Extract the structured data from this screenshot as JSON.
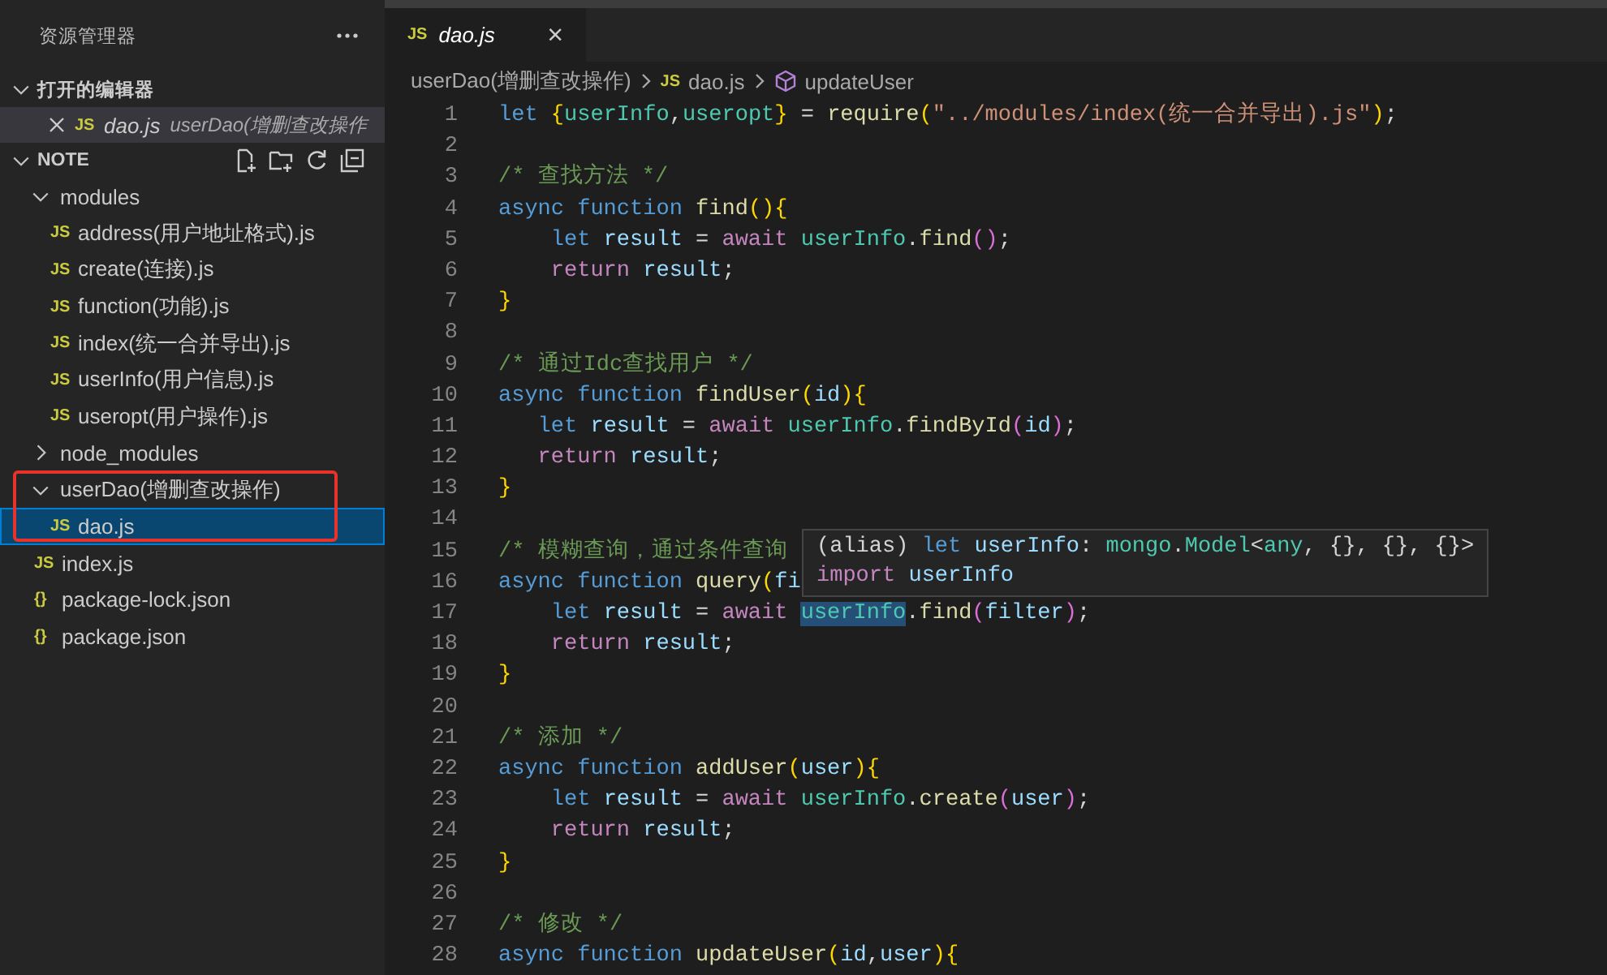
{
  "explorer": {
    "title": "资源管理器",
    "open_editors": {
      "label": "打开的编辑器",
      "expanded": true,
      "items": [
        {
          "icon": "JS",
          "name": "dao.js",
          "description": "userDao(增删查改操作",
          "selected": true
        }
      ]
    },
    "folder": {
      "label": "NOTE",
      "expanded": true,
      "items": [
        {
          "kind": "folder",
          "name": "modules",
          "expanded": true,
          "selected": false,
          "children": [
            {
              "kind": "file",
              "icon": "JS",
              "name": "address(用户地址格式).js",
              "selected": false
            },
            {
              "kind": "file",
              "icon": "JS",
              "name": "create(连接).js",
              "selected": false
            },
            {
              "kind": "file",
              "icon": "JS",
              "name": "function(功能).js",
              "selected": false
            },
            {
              "kind": "file",
              "icon": "JS",
              "name": "index(统一合并导出).js",
              "selected": false
            },
            {
              "kind": "file",
              "icon": "JS",
              "name": "userInfo(用户信息).js",
              "selected": false
            },
            {
              "kind": "file",
              "icon": "JS",
              "name": "useropt(用户操作).js",
              "selected": false
            }
          ]
        },
        {
          "kind": "folder",
          "name": "node_modules",
          "expanded": false,
          "selected": false
        },
        {
          "kind": "folder",
          "name": "userDao(增删查改操作)",
          "expanded": true,
          "selected": false,
          "children": [
            {
              "kind": "file",
              "icon": "JS",
              "name": "dao.js",
              "selected": true
            }
          ]
        },
        {
          "kind": "file",
          "icon": "JS",
          "name": "index.js",
          "selected": false
        },
        {
          "kind": "file",
          "icon": "{}",
          "name": "package-lock.json",
          "selected": false
        },
        {
          "kind": "file",
          "icon": "{}",
          "name": "package.json",
          "selected": false
        }
      ]
    }
  },
  "tabs": [
    {
      "icon": "JS",
      "label": "dao.js",
      "close": "×",
      "selected": true
    }
  ],
  "breadcrumb": [
    {
      "kind": "folder",
      "label": "userDao(增删查改操作)"
    },
    {
      "kind": "file",
      "icon": "JS",
      "label": "dao.js"
    },
    {
      "kind": "symbol",
      "label": "updateUser"
    }
  ],
  "code": [
    {
      "n": "1",
      "tokens": [
        {
          "kind": "kw",
          "text": "let "
        },
        {
          "kind": "br",
          "text": "{"
        },
        {
          "kind": "cv",
          "text": "userInfo"
        },
        {
          "kind": "p",
          "text": ","
        },
        {
          "kind": "cv",
          "text": "useropt"
        },
        {
          "kind": "br",
          "text": "}"
        },
        {
          "kind": "p",
          "text": " = "
        },
        {
          "kind": "fn",
          "text": "require"
        },
        {
          "kind": "br",
          "text": "("
        },
        {
          "kind": "str",
          "text": "\"../modules/index(统一合并导出).js\""
        },
        {
          "kind": "br",
          "text": ")"
        },
        {
          "kind": "p",
          "text": ";"
        }
      ]
    },
    {
      "n": "2"
    },
    {
      "n": "3",
      "tokens": [
        {
          "kind": "cm",
          "text": "/* 查找方法 */"
        }
      ]
    },
    {
      "n": "4",
      "tokens": [
        {
          "kind": "kw",
          "text": "async function "
        },
        {
          "kind": "fn",
          "text": "find"
        },
        {
          "kind": "br",
          "text": "(){"
        }
      ]
    },
    {
      "n": "5",
      "tokens": [
        {
          "kind": "kw",
          "text": "    let "
        },
        {
          "kind": "var",
          "text": "result"
        },
        {
          "kind": "p",
          "text": " = "
        },
        {
          "kind": "ctl",
          "text": "await "
        },
        {
          "kind": "cv",
          "text": "userInfo"
        },
        {
          "kind": "p",
          "text": "."
        },
        {
          "kind": "fn",
          "text": "find"
        },
        {
          "kind": "br2",
          "text": "()"
        },
        {
          "kind": "p",
          "text": ";"
        }
      ]
    },
    {
      "n": "6",
      "tokens": [
        {
          "kind": "ctl",
          "text": "    return "
        },
        {
          "kind": "var",
          "text": "result"
        },
        {
          "kind": "p",
          "text": ";"
        }
      ]
    },
    {
      "n": "7",
      "tokens": [
        {
          "kind": "br",
          "text": "}"
        }
      ]
    },
    {
      "n": "8"
    },
    {
      "n": "9",
      "tokens": [
        {
          "kind": "cm",
          "text": "/* 通过Idc查找用户 */"
        }
      ]
    },
    {
      "n": "10",
      "tokens": [
        {
          "kind": "kw",
          "text": "async function "
        },
        {
          "kind": "fn",
          "text": "findUser"
        },
        {
          "kind": "br",
          "text": "("
        },
        {
          "kind": "var",
          "text": "id"
        },
        {
          "kind": "br",
          "text": "){"
        }
      ]
    },
    {
      "n": "11",
      "tokens": [
        {
          "kind": "kw",
          "text": "   let "
        },
        {
          "kind": "var",
          "text": "result"
        },
        {
          "kind": "p",
          "text": " = "
        },
        {
          "kind": "ctl",
          "text": "await "
        },
        {
          "kind": "cv",
          "text": "userInfo"
        },
        {
          "kind": "p",
          "text": "."
        },
        {
          "kind": "fn",
          "text": "findById"
        },
        {
          "kind": "br2",
          "text": "("
        },
        {
          "kind": "var",
          "text": "id"
        },
        {
          "kind": "br2",
          "text": ")"
        },
        {
          "kind": "p",
          "text": ";"
        }
      ]
    },
    {
      "n": "12",
      "tokens": [
        {
          "kind": "ctl",
          "text": "   return "
        },
        {
          "kind": "var",
          "text": "result"
        },
        {
          "kind": "p",
          "text": ";"
        }
      ]
    },
    {
      "n": "13",
      "tokens": [
        {
          "kind": "br",
          "text": "}"
        }
      ]
    },
    {
      "n": "14"
    },
    {
      "n": "15",
      "tokens": [
        {
          "kind": "cm",
          "text": "/* 模糊查询，通过条件查询"
        }
      ]
    },
    {
      "n": "16",
      "tokens": [
        {
          "kind": "kw",
          "text": "async function "
        },
        {
          "kind": "fn",
          "text": "query"
        },
        {
          "kind": "br",
          "text": "("
        },
        {
          "kind": "var",
          "text": "fi"
        }
      ]
    },
    {
      "n": "17",
      "tokens": [
        {
          "kind": "kw",
          "text": "    let "
        },
        {
          "kind": "var",
          "text": "result"
        },
        {
          "kind": "p",
          "text": " = "
        },
        {
          "kind": "ctl",
          "text": "await "
        },
        {
          "kind": "hl",
          "text": "userInfo"
        },
        {
          "kind": "p",
          "text": "."
        },
        {
          "kind": "fn",
          "text": "find"
        },
        {
          "kind": "br2",
          "text": "("
        },
        {
          "kind": "var",
          "text": "filter"
        },
        {
          "kind": "br2",
          "text": ")"
        },
        {
          "kind": "p",
          "text": ";"
        }
      ]
    },
    {
      "n": "18",
      "tokens": [
        {
          "kind": "ctl",
          "text": "    return "
        },
        {
          "kind": "var",
          "text": "result"
        },
        {
          "kind": "p",
          "text": ";"
        }
      ]
    },
    {
      "n": "19",
      "tokens": [
        {
          "kind": "br",
          "text": "}"
        }
      ]
    },
    {
      "n": "20"
    },
    {
      "n": "21",
      "tokens": [
        {
          "kind": "cm",
          "text": "/* 添加 */"
        }
      ]
    },
    {
      "n": "22",
      "tokens": [
        {
          "kind": "kw",
          "text": "async function "
        },
        {
          "kind": "fn",
          "text": "addUser"
        },
        {
          "kind": "br",
          "text": "("
        },
        {
          "kind": "var",
          "text": "user"
        },
        {
          "kind": "br",
          "text": "){"
        }
      ]
    },
    {
      "n": "23",
      "tokens": [
        {
          "kind": "kw",
          "text": "    let "
        },
        {
          "kind": "var",
          "text": "result"
        },
        {
          "kind": "p",
          "text": " = "
        },
        {
          "kind": "ctl",
          "text": "await "
        },
        {
          "kind": "cv",
          "text": "userInfo"
        },
        {
          "kind": "p",
          "text": "."
        },
        {
          "kind": "fn",
          "text": "create"
        },
        {
          "kind": "br2",
          "text": "("
        },
        {
          "kind": "var",
          "text": "user"
        },
        {
          "kind": "br2",
          "text": ")"
        },
        {
          "kind": "p",
          "text": ";"
        }
      ]
    },
    {
      "n": "24",
      "tokens": [
        {
          "kind": "ctl",
          "text": "    return "
        },
        {
          "kind": "var",
          "text": "result"
        },
        {
          "kind": "p",
          "text": ";"
        }
      ]
    },
    {
      "n": "25",
      "tokens": [
        {
          "kind": "br",
          "text": "}"
        }
      ]
    },
    {
      "n": "26"
    },
    {
      "n": "27",
      "tokens": [
        {
          "kind": "cm",
          "text": "/* 修改 */"
        }
      ]
    },
    {
      "n": "28",
      "tokens": [
        {
          "kind": "kw",
          "text": "async function "
        },
        {
          "kind": "fn",
          "text": "updateUser"
        },
        {
          "kind": "br",
          "text": "("
        },
        {
          "kind": "var",
          "text": "id"
        },
        {
          "kind": "p",
          "text": ","
        },
        {
          "kind": "var",
          "text": "user"
        },
        {
          "kind": "br",
          "text": "){"
        }
      ]
    }
  ],
  "hover_tooltip": {
    "lines": [
      [
        {
          "kind": "p",
          "text": "(alias) "
        },
        {
          "kind": "kw",
          "text": "let "
        },
        {
          "kind": "var",
          "text": "userInfo"
        },
        {
          "kind": "p",
          "text": ": "
        },
        {
          "kind": "cv",
          "text": "mongo"
        },
        {
          "kind": "p",
          "text": "."
        },
        {
          "kind": "cv",
          "text": "Model"
        },
        {
          "kind": "p",
          "text": "<"
        },
        {
          "kind": "cv",
          "text": "any"
        },
        {
          "kind": "p",
          "text": ", {}, {}, {}>"
        }
      ],
      [
        {
          "kind": "ctl",
          "text": "import "
        },
        {
          "kind": "var",
          "text": "userInfo"
        }
      ]
    ]
  }
}
